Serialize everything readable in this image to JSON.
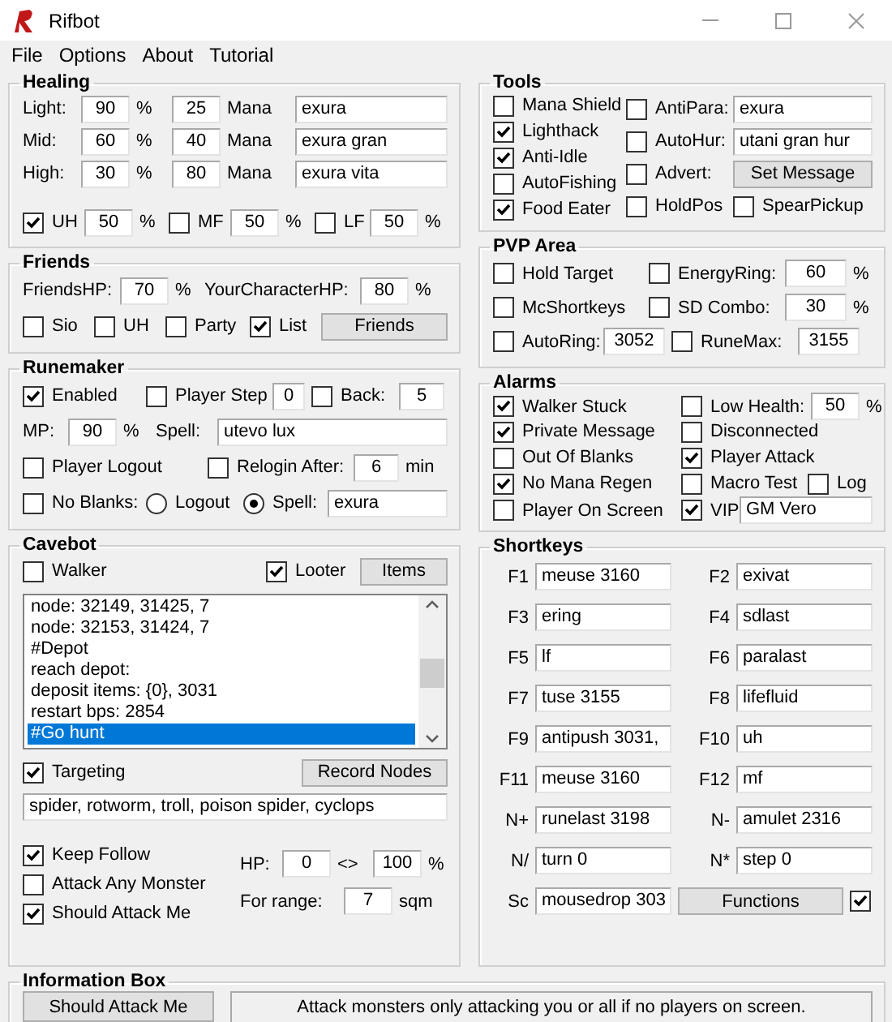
{
  "window": {
    "title": "Rifbot"
  },
  "menu": [
    "File",
    "Options",
    "About",
    "Tutorial"
  ],
  "left_column": [
    {
      "kind": "form",
      "title": "Healing",
      "rows": [
        {
          "items": [
            {
              "kind": "label",
              "text": "Light:"
            },
            {
              "kind": "number",
              "value": "90"
            },
            {
              "kind": "label",
              "text": "%"
            },
            {
              "kind": "number",
              "value": "25"
            },
            {
              "kind": "label",
              "text": "Mana"
            },
            {
              "kind": "field",
              "value": "exura"
            }
          ]
        },
        {
          "items": [
            {
              "kind": "label",
              "text": "Mid:"
            },
            {
              "kind": "number",
              "value": "60"
            },
            {
              "kind": "label",
              "text": "%"
            },
            {
              "kind": "number",
              "value": "40"
            },
            {
              "kind": "label",
              "text": "Mana"
            },
            {
              "kind": "field",
              "value": "exura gran"
            }
          ]
        },
        {
          "items": [
            {
              "kind": "label",
              "text": "High:"
            },
            {
              "kind": "number",
              "value": "30"
            },
            {
              "kind": "label",
              "text": "%"
            },
            {
              "kind": "number",
              "value": "80"
            },
            {
              "kind": "label",
              "text": "Mana"
            },
            {
              "kind": "field",
              "value": "exura vita"
            }
          ]
        },
        {
          "items": [
            {
              "kind": "checkbox",
              "text": "UH",
              "checked": true
            },
            {
              "kind": "number",
              "value": "50"
            },
            {
              "kind": "label",
              "text": "%"
            },
            {
              "kind": "checkbox",
              "text": "MF",
              "checked": false
            },
            {
              "kind": "number",
              "value": "50"
            },
            {
              "kind": "label",
              "text": "%"
            },
            {
              "kind": "checkbox",
              "text": "LF",
              "checked": false
            },
            {
              "kind": "number",
              "value": "50"
            },
            {
              "kind": "label",
              "text": "%"
            }
          ]
        }
      ]
    },
    {
      "kind": "form",
      "title": "Friends",
      "rows": [
        {
          "items": [
            {
              "kind": "label",
              "text": "FriendsHP:"
            },
            {
              "kind": "number",
              "value": "70"
            },
            {
              "kind": "label",
              "text": "%"
            },
            {
              "kind": "label",
              "text": "YourCharacterHP:"
            },
            {
              "kind": "number",
              "value": "80"
            },
            {
              "kind": "label",
              "text": "%"
            }
          ]
        },
        {
          "items": [
            {
              "kind": "checkbox",
              "text": "Sio",
              "checked": false
            },
            {
              "kind": "checkbox",
              "text": "UH",
              "checked": false
            },
            {
              "kind": "checkbox",
              "text": "Party",
              "checked": false
            },
            {
              "kind": "checkbox",
              "text": "List",
              "checked": true
            },
            {
              "kind": "button",
              "text": "Friends"
            }
          ]
        }
      ]
    },
    {
      "kind": "form",
      "title": "Runemaker",
      "rows": [
        {
          "items": [
            {
              "kind": "checkbox",
              "text": "Enabled",
              "checked": true
            },
            {
              "kind": "checkbox",
              "text": "Player Step",
              "checked": false
            },
            {
              "kind": "number",
              "value": "0"
            },
            {
              "kind": "checkbox",
              "text": "Back:",
              "checked": false
            },
            {
              "kind": "number",
              "value": "5"
            }
          ]
        },
        {
          "items": [
            {
              "kind": "label",
              "text": "MP:"
            },
            {
              "kind": "number",
              "value": "90"
            },
            {
              "kind": "label",
              "text": "%"
            },
            {
              "kind": "label",
              "text": "Spell:"
            },
            {
              "kind": "field",
              "value": "utevo lux"
            }
          ]
        },
        {
          "items": [
            {
              "kind": "checkbox",
              "text": "Player Logout",
              "checked": false
            },
            {
              "kind": "checkbox",
              "text": "Relogin After:",
              "checked": false
            },
            {
              "kind": "number",
              "value": "6"
            },
            {
              "kind": "label",
              "text": "min"
            }
          ]
        },
        {
          "items": [
            {
              "kind": "checkbox",
              "text": "No Blanks:",
              "checked": false
            },
            {
              "kind": "radio",
              "text": "Logout",
              "selected": false
            },
            {
              "kind": "radio",
              "text": "Spell:",
              "selected": true
            },
            {
              "kind": "field",
              "value": "exura"
            }
          ]
        }
      ]
    },
    {
      "kind": "cavebot",
      "title": "Cavebot",
      "walker": {
        "text": "Walker",
        "checked": false
      },
      "looter": {
        "text": "Looter",
        "checked": true
      },
      "items_button": "Items",
      "nodes": [
        {
          "text": "node: 32149, 31425, 7",
          "selected": false
        },
        {
          "text": "node: 32153, 31424, 7",
          "selected": false
        },
        {
          "text": "#Depot",
          "selected": false
        },
        {
          "text": "reach depot:",
          "selected": false
        },
        {
          "text": "deposit items: {0}, 3031",
          "selected": false
        },
        {
          "text": "restart bps: 2854",
          "selected": false
        },
        {
          "text": "#Go hunt",
          "selected": true
        }
      ],
      "targeting": {
        "text": "Targeting",
        "checked": true
      },
      "record_button": "Record Nodes",
      "targets": "spider, rotworm, troll, poison spider, cyclops",
      "options": [
        {
          "text": "Keep Follow",
          "checked": true
        },
        {
          "text": "Attack Any Monster",
          "checked": false
        },
        {
          "text": "Should Attack Me",
          "checked": true
        }
      ],
      "hp": {
        "label": "HP:",
        "min": "0",
        "separator": "<>",
        "max": "100",
        "unit": "%"
      },
      "range": {
        "label": "For range:",
        "value": "7",
        "unit": "sqm"
      }
    }
  ],
  "right_column": [
    {
      "kind": "split",
      "title": "Tools",
      "columns": [
        {
          "rows": [
            {
              "items": [
                {
                  "kind": "checkbox",
                  "text": "Mana Shield",
                  "checked": false
                }
              ]
            },
            {
              "items": [
                {
                  "kind": "checkbox",
                  "text": "Lighthack",
                  "checked": true
                }
              ]
            },
            {
              "items": [
                {
                  "kind": "checkbox",
                  "text": "Anti-Idle",
                  "checked": true
                }
              ]
            },
            {
              "items": [
                {
                  "kind": "checkbox",
                  "text": "AutoFishing",
                  "checked": false
                }
              ]
            },
            {
              "items": [
                {
                  "kind": "checkbox",
                  "text": "Food Eater",
                  "checked": true
                }
              ]
            }
          ]
        },
        {
          "rows": [
            {
              "items": [
                {
                  "kind": "checkbox",
                  "text": "AntiPara:",
                  "checked": false
                },
                {
                  "kind": "field",
                  "value": "exura"
                }
              ]
            },
            {
              "items": [
                {
                  "kind": "checkbox",
                  "text": "AutoHur:",
                  "checked": false
                },
                {
                  "kind": "field",
                  "value": "utani gran hur"
                }
              ]
            },
            {
              "items": [
                {
                  "kind": "checkbox",
                  "text": "Advert:",
                  "checked": false
                },
                {
                  "kind": "button",
                  "text": "Set Message"
                }
              ]
            },
            {
              "items": [
                {
                  "kind": "checkbox",
                  "text": "HoldPos",
                  "checked": false
                },
                {
                  "kind": "checkbox",
                  "text": "SpearPickup",
                  "checked": false
                }
              ]
            }
          ]
        }
      ]
    },
    {
      "kind": "form",
      "title": "PVP Area",
      "rows": [
        {
          "items": [
            {
              "kind": "checkbox",
              "text": "Hold Target",
              "checked": false
            },
            {
              "kind": "checkbox",
              "text": "EnergyRing:",
              "checked": false
            },
            {
              "kind": "number",
              "value": "60"
            },
            {
              "kind": "label",
              "text": "%"
            }
          ]
        },
        {
          "items": [
            {
              "kind": "checkbox",
              "text": "McShortkeys",
              "checked": false
            },
            {
              "kind": "checkbox",
              "text": "SD Combo:",
              "checked": false
            },
            {
              "kind": "number",
              "value": "30"
            },
            {
              "kind": "label",
              "text": "%"
            }
          ]
        },
        {
          "items": [
            {
              "kind": "checkbox",
              "text": "AutoRing:",
              "checked": false
            },
            {
              "kind": "number",
              "value": "3052"
            },
            {
              "kind": "checkbox",
              "text": "RuneMax:",
              "checked": false
            },
            {
              "kind": "number",
              "value": "3155"
            }
          ]
        }
      ]
    },
    {
      "kind": "form",
      "title": "Alarms",
      "rows": [
        {
          "items": [
            {
              "kind": "checkbox",
              "text": "Walker Stuck",
              "checked": true
            },
            {
              "kind": "checkbox",
              "text": "Low Health:",
              "checked": false
            },
            {
              "kind": "number",
              "value": "50"
            },
            {
              "kind": "label",
              "text": "%"
            }
          ]
        },
        {
          "items": [
            {
              "kind": "checkbox",
              "text": "Private Message",
              "checked": true
            },
            {
              "kind": "checkbox",
              "text": "Disconnected",
              "checked": false
            }
          ]
        },
        {
          "items": [
            {
              "kind": "checkbox",
              "text": "Out Of Blanks",
              "checked": false
            },
            {
              "kind": "checkbox",
              "text": "Player Attack",
              "checked": true
            }
          ]
        },
        {
          "items": [
            {
              "kind": "checkbox",
              "text": "No Mana Regen",
              "checked": true
            },
            {
              "kind": "checkbox",
              "text": "Macro Test",
              "checked": false
            },
            {
              "kind": "checkbox",
              "text": "Log",
              "checked": false
            }
          ]
        },
        {
          "items": [
            {
              "kind": "checkbox",
              "text": "Player On Screen",
              "checked": false
            },
            {
              "kind": "checkbox",
              "text": "VIP",
              "checked": true
            },
            {
              "kind": "field",
              "value": "GM Vero"
            }
          ]
        }
      ]
    },
    {
      "kind": "form",
      "title": "Shortkeys",
      "rows": [
        {
          "items": [
            {
              "kind": "key",
              "text": "F1"
            },
            {
              "kind": "field",
              "value": "meuse 3160"
            },
            {
              "kind": "key",
              "text": "F2"
            },
            {
              "kind": "field",
              "value": "exivat"
            }
          ]
        },
        {
          "items": [
            {
              "kind": "key",
              "text": "F3"
            },
            {
              "kind": "field",
              "value": "ering"
            },
            {
              "kind": "key",
              "text": "F4"
            },
            {
              "kind": "field",
              "value": "sdlast"
            }
          ]
        },
        {
          "items": [
            {
              "kind": "key",
              "text": "F5"
            },
            {
              "kind": "field",
              "value": "lf"
            },
            {
              "kind": "key",
              "text": "F6"
            },
            {
              "kind": "field",
              "value": "paralast"
            }
          ]
        },
        {
          "items": [
            {
              "kind": "key",
              "text": "F7"
            },
            {
              "kind": "field",
              "value": "tuse 3155"
            },
            {
              "kind": "key",
              "text": "F8"
            },
            {
              "kind": "field",
              "value": "lifefluid"
            }
          ]
        },
        {
          "items": [
            {
              "kind": "key",
              "text": "F9"
            },
            {
              "kind": "field",
              "value": "antipush 3031,"
            },
            {
              "kind": "key",
              "text": "F10"
            },
            {
              "kind": "field",
              "value": "uh"
            }
          ]
        },
        {
          "items": [
            {
              "kind": "key",
              "text": "F11"
            },
            {
              "kind": "field",
              "value": "meuse 3160"
            },
            {
              "kind": "key",
              "text": "F12"
            },
            {
              "kind": "field",
              "value": "mf"
            }
          ]
        },
        {
          "items": [
            {
              "kind": "key",
              "text": "N+"
            },
            {
              "kind": "field",
              "value": "runelast 3198"
            },
            {
              "kind": "key",
              "text": "N-"
            },
            {
              "kind": "field",
              "value": "amulet 2316"
            }
          ]
        },
        {
          "items": [
            {
              "kind": "key",
              "text": "N/"
            },
            {
              "kind": "field",
              "value": "turn 0"
            },
            {
              "kind": "key",
              "text": "N*"
            },
            {
              "kind": "field",
              "value": "step 0"
            }
          ]
        },
        {
          "items": [
            {
              "kind": "key",
              "text": "Sc"
            },
            {
              "kind": "field",
              "value": "mousedrop 303"
            },
            {
              "kind": "button",
              "text": "Functions"
            },
            {
              "kind": "checkbox",
              "checked": true
            }
          ]
        }
      ]
    }
  ],
  "information_box": {
    "title": "Information Box",
    "button": "Should Attack Me",
    "message": "Attack monsters only attacking you or all if no players on screen."
  }
}
